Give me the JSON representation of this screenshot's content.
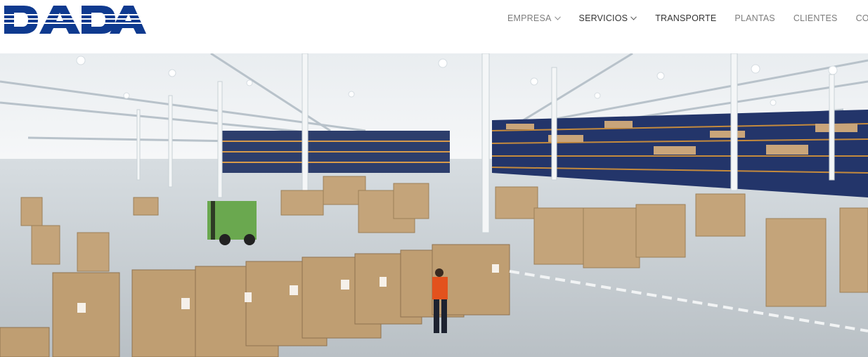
{
  "brand": {
    "logo_text": "DADA",
    "logo_color": "#0f3a8f"
  },
  "nav": {
    "items": [
      {
        "label": "EMPRESA",
        "has_dropdown": true
      },
      {
        "label": "SERVICIOS",
        "has_dropdown": true
      },
      {
        "label": "TRANSPORTE",
        "has_dropdown": false
      },
      {
        "label": "PLANTAS",
        "has_dropdown": false
      },
      {
        "label": "CLIENTES",
        "has_dropdown": false
      },
      {
        "label": "CONTACTO",
        "has_dropdown": false
      }
    ]
  },
  "hero": {
    "image": "warehouse-photo",
    "colors": {
      "floor": "#c9d0d5",
      "ceiling": "#f3f5f6",
      "rack": "#23356a",
      "box": "#c4a47a"
    }
  }
}
